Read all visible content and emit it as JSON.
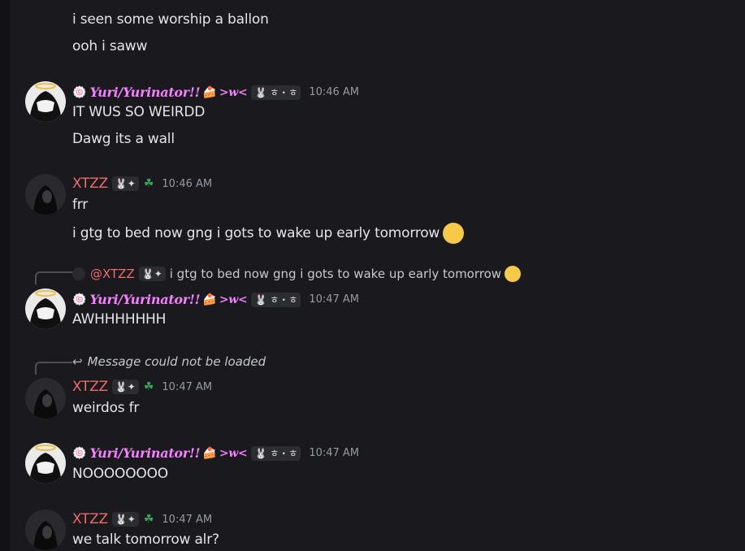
{
  "messages_top": [
    {
      "text": "i seen some worship a ballon"
    },
    {
      "text": "ooh i saww"
    }
  ],
  "group1": {
    "username": "Yuri/Yurinator!!",
    "tag_face": ">w<",
    "tag_text": "ㅎ・ㅎ",
    "time": "10:46 AM",
    "lines": [
      "IT WUS SO WEIRDD",
      "Dawg its a wall"
    ]
  },
  "group2": {
    "username": "XTZZ",
    "time": "10:46 AM",
    "lines": [
      "frr",
      "i gtg to bed now gng i gots to wake up early tomorrow"
    ]
  },
  "group3": {
    "reply_mention": "@XTZZ",
    "reply_text": "i gtg to bed now gng i gots to wake up early tomorrow",
    "username": "Yuri/Yurinator!!",
    "tag_face": ">w<",
    "tag_text": "ㅎ・ㅎ",
    "time": "10:47 AM",
    "lines": [
      "AWHHHHHHH"
    ]
  },
  "group4": {
    "reply_text": "Message could not be loaded",
    "username": "XTZZ",
    "time": "10:47 AM",
    "lines": [
      "weirdos fr"
    ]
  },
  "group5": {
    "username": "Yuri/Yurinator!!",
    "tag_face": ">w<",
    "tag_text": "ㅎ・ㅎ",
    "time": "10:47 AM",
    "lines": [
      "NOOOOOOOO"
    ]
  },
  "group6": {
    "username": "XTZZ",
    "time": "10:47 AM",
    "lines": [
      "we talk tomorrow alr?"
    ]
  },
  "icons": {
    "yuri_avatar": "anime-angel-avatar",
    "xtzz_avatar": "dark-hooded-avatar",
    "reply_icon": "reply-arrow-icon",
    "pleading_emoji": "pleading-face-emoji"
  }
}
